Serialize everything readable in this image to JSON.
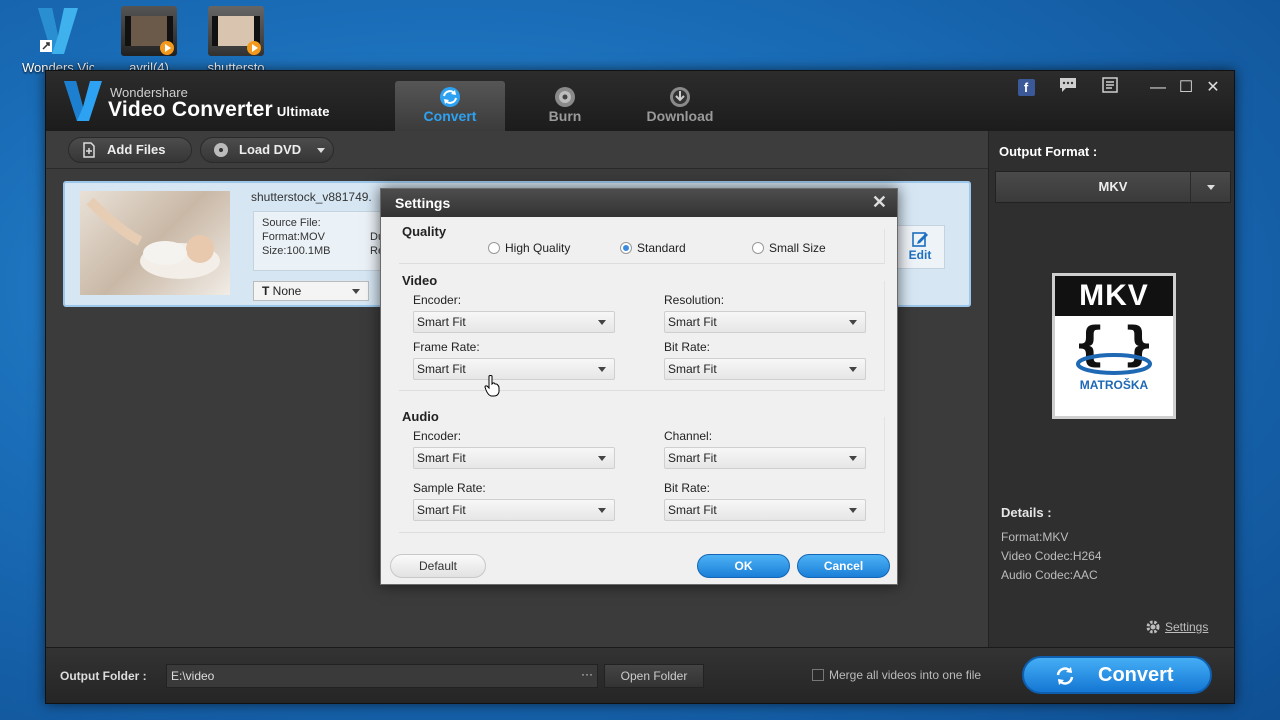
{
  "desktop": {
    "icons": [
      {
        "label": "Wonders Vic",
        "icon": "app-icon"
      },
      {
        "label": "avril(4)",
        "icon": "video-file-icon"
      },
      {
        "label": "shuttersto",
        "icon": "video-file-icon"
      }
    ]
  },
  "app": {
    "brand": "Wondershare",
    "product": "Video Converter",
    "edition": "Ultimate"
  },
  "tabs": [
    {
      "label": "Convert",
      "active": true,
      "icon": "convert-icon"
    },
    {
      "label": "Burn",
      "active": false,
      "icon": "disc-icon"
    },
    {
      "label": "Download",
      "active": false,
      "icon": "download-icon"
    }
  ],
  "window_controls": {
    "facebook": "f",
    "minimize": "—",
    "maximize": "☐",
    "close": "✕"
  },
  "toolbar": {
    "add_files": "Add Files",
    "load_dvd": "Load DVD"
  },
  "file": {
    "name": "shutterstock_v881749.",
    "source_label": "Source File:",
    "format": "Format:MOV",
    "size": "Size:100.1MB",
    "du": "Du",
    "re": "Re",
    "subtitle": "None",
    "edit": "Edit"
  },
  "output_format": {
    "label": "Output Format :",
    "selected": "MKV",
    "badge_title": "MKV",
    "badge_sub": "MATROŠKA",
    "details_heading": "Details :",
    "details": [
      "Format:MKV",
      "Video Codec:H264",
      "Audio Codec:AAC"
    ],
    "settings_link": "Settings"
  },
  "bottom": {
    "output_folder_label": "Output Folder :",
    "output_folder_value": "E:\\video",
    "dots": "···",
    "open_folder": "Open Folder",
    "merge_label": "Merge all videos into one file",
    "convert": "Convert"
  },
  "dialog": {
    "title": "Settings",
    "quality": {
      "label": "Quality",
      "options": [
        "High Quality",
        "Standard",
        "Small Size"
      ],
      "selected": "Standard"
    },
    "video": {
      "label": "Video",
      "encoder_label": "Encoder:",
      "encoder_value": "Smart Fit",
      "resolution_label": "Resolution:",
      "resolution_value": "Smart Fit",
      "frame_rate_label": "Frame Rate:",
      "frame_rate_value": "Smart Fit",
      "bit_rate_label": "Bit Rate:",
      "bit_rate_value": "Smart Fit"
    },
    "audio": {
      "label": "Audio",
      "encoder_label": "Encoder:",
      "encoder_value": "Smart Fit",
      "channel_label": "Channel:",
      "channel_value": "Smart Fit",
      "sample_rate_label": "Sample Rate:",
      "sample_rate_value": "Smart Fit",
      "bit_rate_label": "Bit Rate:",
      "bit_rate_value": "Smart Fit"
    },
    "buttons": {
      "default": "Default",
      "ok": "OK",
      "cancel": "Cancel"
    }
  },
  "colors": {
    "accent": "#2ea2f2",
    "desktop": "#1a6db8",
    "window": "#3b3b3b"
  }
}
